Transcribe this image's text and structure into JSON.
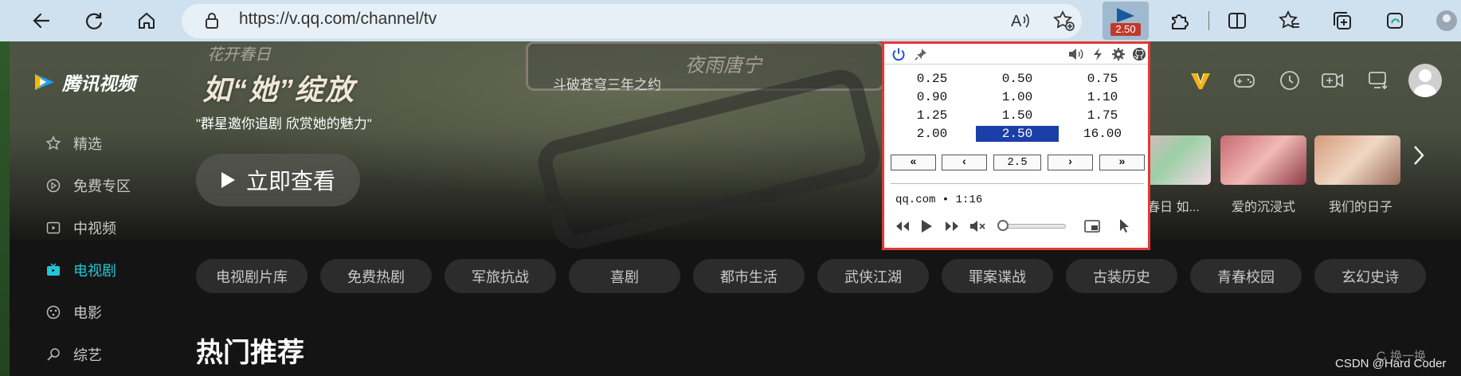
{
  "browser": {
    "url": "https://v.qq.com/channel/tv",
    "extension_badge": "2.50",
    "icons": [
      "back-icon",
      "reload-icon",
      "home-icon",
      "lock-icon",
      "read-aloud-icon",
      "add-favorite-icon",
      "speed-extension-icon",
      "extensions-icon",
      "split-screen-icon",
      "favorites-icon",
      "collections-icon",
      "browser-essentials-icon",
      "profile-icon"
    ]
  },
  "site": {
    "logo_text": "腾讯视频",
    "hero": {
      "top_text": "花开春日",
      "big_title": "如“她”绽放",
      "subtitle": "\"群星邀你追剧 欣赏她的魅力\"",
      "watch_button": "立即查看",
      "card_caption": "斗破苍穹三年之约",
      "card_caption2": "夜雨唐宁"
    },
    "sidebar": [
      {
        "label": "精选",
        "icon": "star-icon",
        "active": false
      },
      {
        "label": "免费专区",
        "icon": "play-circle-icon",
        "active": false
      },
      {
        "label": "中视频",
        "icon": "video-box-icon",
        "active": false
      },
      {
        "label": "电视剧",
        "icon": "tv-icon",
        "active": true
      },
      {
        "label": "电影",
        "icon": "film-reel-icon",
        "active": false
      },
      {
        "label": "综艺",
        "icon": "microphone-icon",
        "active": false
      }
    ],
    "thumbnails": [
      {
        "label": "春日 如..."
      },
      {
        "label": "爱的沉浸式"
      },
      {
        "label": "我们的日子"
      }
    ],
    "chips": [
      "电视剧片库",
      "免费热剧",
      "军旅抗战",
      "喜剧",
      "都市生活",
      "武侠江湖",
      "罪案谍战",
      "古装历史",
      "青春校园",
      "玄幻史诗"
    ],
    "section_title": "热门推荐",
    "refresh_label": "换一换",
    "colors": {
      "accent": "#22c6d6",
      "background": "#141414"
    }
  },
  "popup": {
    "speeds": [
      [
        "0.25",
        "0.50",
        "0.75"
      ],
      [
        "0.90",
        "1.00",
        "1.10"
      ],
      [
        "1.25",
        "1.50",
        "1.75"
      ],
      [
        "2.00",
        "2.50",
        "16.00"
      ]
    ],
    "selected_speed": "2.50",
    "controls": {
      "fast_slower": "«",
      "slower": "‹",
      "current": "2.5",
      "faster": "›",
      "fast_faster": "»"
    },
    "site_info": "qq.com • 1:16",
    "progress": 0,
    "colors": {
      "border": "#e53935",
      "selected": "#1b3fa8"
    }
  },
  "watermark": "CSDN @Hard Coder"
}
